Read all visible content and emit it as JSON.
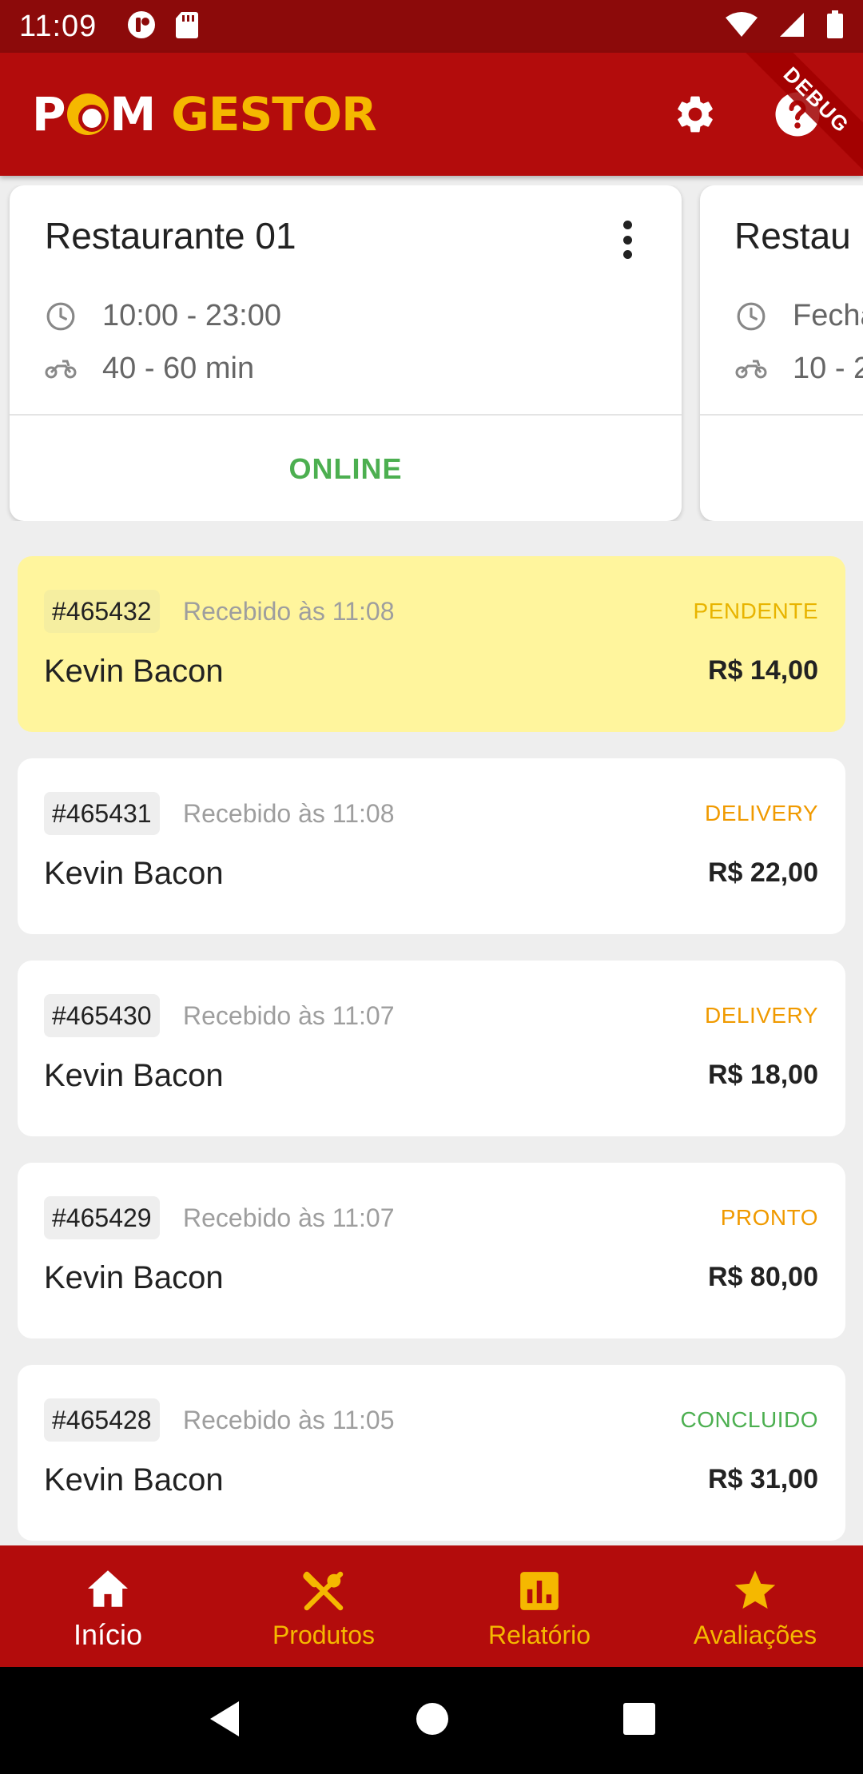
{
  "status_bar": {
    "time": "11:09"
  },
  "app_bar": {
    "logo": {
      "p": "P",
      "m": "M",
      "gestor": "GESTOR"
    },
    "debug": "DEBUG"
  },
  "restaurants": [
    {
      "name": "Restaurante 01",
      "hours": "10:00 - 23:00",
      "delivery_time": "40 - 60 min",
      "status": "ONLINE"
    },
    {
      "name": "Restau",
      "hours": "Fecha",
      "delivery_time": "10 - 2"
    }
  ],
  "orders": [
    {
      "id": "#465432",
      "received": "Recebido às 11:08",
      "status": "PENDENTE",
      "customer": "Kevin Bacon",
      "total": "R$ 14,00",
      "status_color": "#e8b400"
    },
    {
      "id": "#465431",
      "received": "Recebido às 11:08",
      "status": "DELIVERY",
      "customer": "Kevin Bacon",
      "total": "R$ 22,00",
      "status_color": "#f09a00"
    },
    {
      "id": "#465430",
      "received": "Recebido às 11:07",
      "status": "DELIVERY",
      "customer": "Kevin Bacon",
      "total": "R$ 18,00",
      "status_color": "#f09a00"
    },
    {
      "id": "#465429",
      "received": "Recebido às 11:07",
      "status": "PRONTO",
      "customer": "Kevin Bacon",
      "total": "R$ 80,00",
      "status_color": "#f09a00"
    },
    {
      "id": "#465428",
      "received": "Recebido às 11:05",
      "status": "CONCLUIDO",
      "customer": "Kevin Bacon",
      "total": "R$ 31,00",
      "status_color": "#4caf50"
    }
  ],
  "bottom_nav": [
    {
      "label": "Início",
      "icon": "home-icon",
      "active": true
    },
    {
      "label": "Produtos",
      "icon": "utensils-icon",
      "active": false
    },
    {
      "label": "Relatório",
      "icon": "bar-chart-icon",
      "active": false
    },
    {
      "label": "Avaliações",
      "icon": "star-icon",
      "active": false
    }
  ],
  "colors": {
    "brand_red": "#b30c0c",
    "brand_yellow": "#f5b800",
    "online_green": "#4caf50",
    "pending_bg": "#fff59d"
  }
}
